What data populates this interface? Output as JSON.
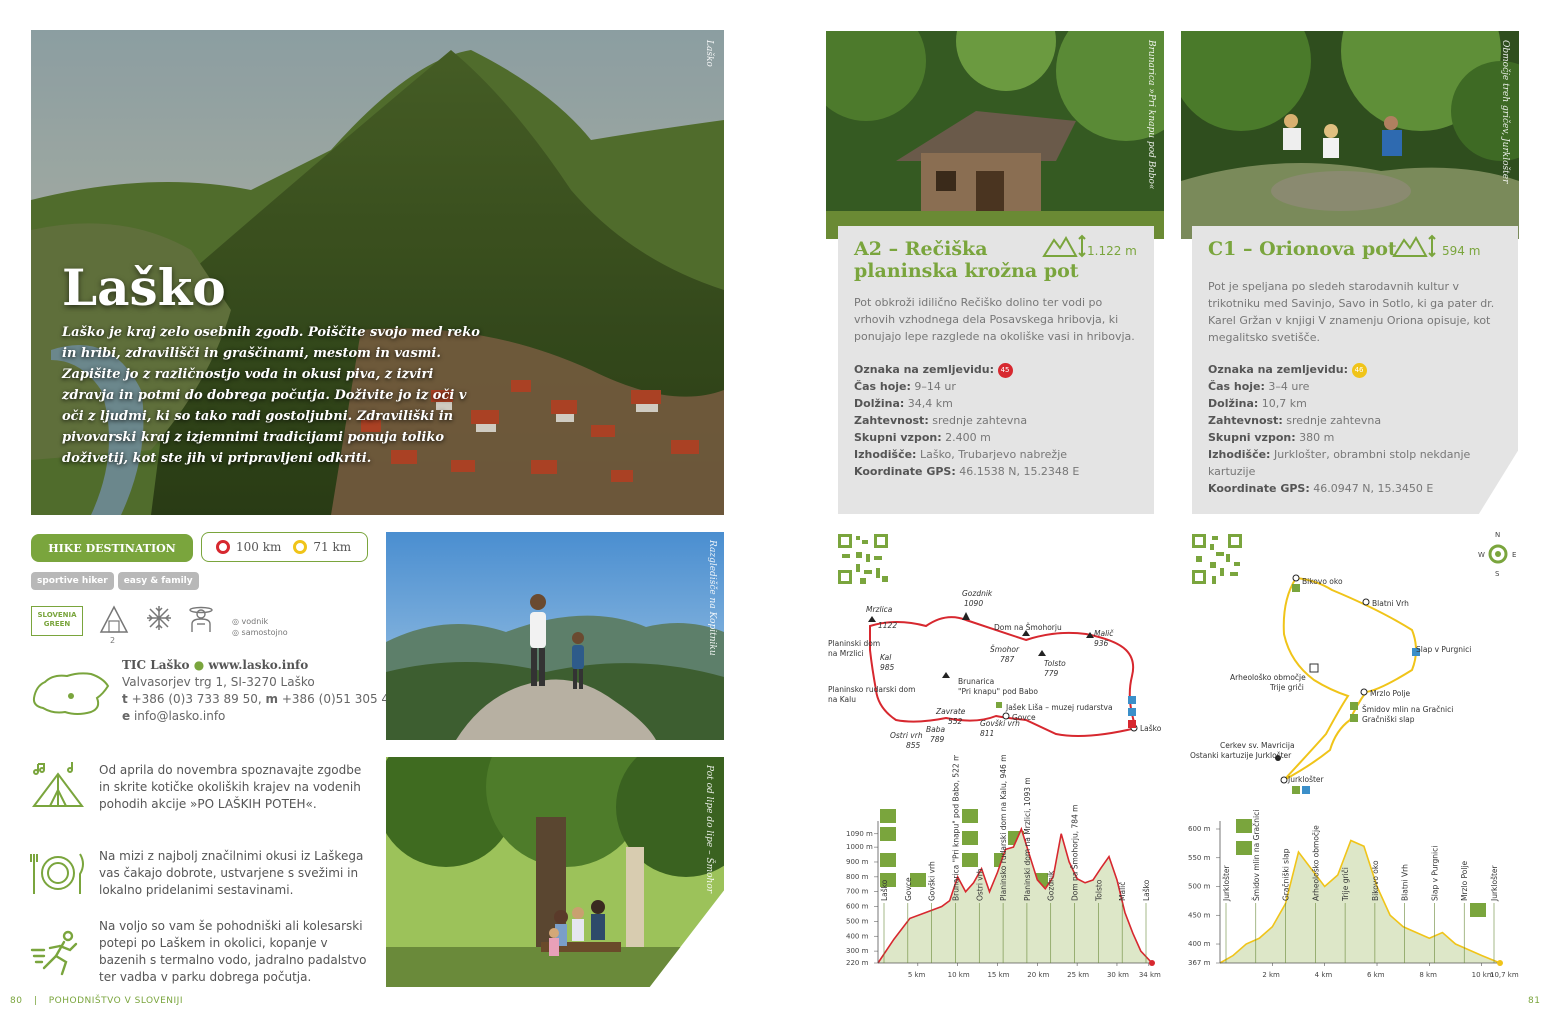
{
  "left_page": {
    "hero": {
      "title": "Laško",
      "intro": "Laško je kraj zelo osebnih zgodb. Poiščite svojo med reko in hribi, zdravilišči in graščinami, mestom in vasmi. Zapišite jo z različnostjo voda in okusi piva, z izviri zdravja in potmi do dobrega počutja. Doživite jo iz oči v oči z ljudmi, ki so tako radi gostoljubni. Zdraviliški in pivovarski kraj z izjemnimi tradicijami ponuja toliko doživetij, kot ste jih vi pripravljeni odkriti.",
      "credit": "Laško"
    },
    "destination_button": "HIKE DESTINATION",
    "distances": {
      "red": "100 km",
      "yellow": "71 km"
    },
    "tags": [
      "sportive hiker",
      "easy & family"
    ],
    "icons": [
      {
        "name": "slovenia-green-badge",
        "text": "SLOVENIA GREEN"
      },
      {
        "name": "hut-icon",
        "count": "2"
      },
      {
        "name": "snowflake-icon"
      },
      {
        "name": "guide-icon"
      }
    ],
    "guide_options": [
      "vodnik",
      "samostojno"
    ],
    "contact": {
      "tic": "TIC Laško",
      "web": "www.lasko.info",
      "address": "Valvasorjev trg 1, SI-3270 Laško",
      "t_label": "t",
      "phone": "+386 (0)3 733 89 50,",
      "m_label": "m",
      "mobile": "+386 (0)51 305 466",
      "e_label": "e",
      "email": "info@lasko.info"
    },
    "features": [
      {
        "icon": "tent-music-icon",
        "text": "Od aprila do novembra spoznavajte zgodbe in skrite kotičke okoliških krajev na vodenih pohodih akcije »PO LAŠKIH POTEH«."
      },
      {
        "icon": "plate-cutlery-icon",
        "text": "Na mizi z najbolj značilnimi okusi iz Laškega vas čakajo dobrote, ustvarjene s svežimi in lokalno pridelanimi sestavinami."
      },
      {
        "icon": "runner-icon",
        "text": "Na voljo so vam še pohodniški ali kolesarski potepi po Laškem in okolici, kopanje v bazenih s termalno vodo, jadralno padalstvo ter vadba v parku dobrega počutja."
      }
    ],
    "photo_credits": [
      "Razgledišče na Kopitniku",
      "Pot od lipe do lipe – Šmohor"
    ],
    "footer": {
      "page": "80",
      "separator": "|",
      "title": "POHODNIŠTVO V SLOVENIJI"
    }
  },
  "right_page": {
    "photo_credits": [
      "Brunarica »Pri knapu pod Babo«",
      "Območje treh gričev, Jurklošter"
    ],
    "routes": [
      {
        "code_title_1": "A2 – Rečiška",
        "code_title_2": "planinska krožna pot",
        "elevation": "1.122 m",
        "description": "Pot obkroži idilično Rečiško dolino ter vodi po vrhovih vzhodnega dela Posavskega hribovja, ki ponujajo lepe razglede na okoliške vasi in hribovja.",
        "map_label": "Oznaka na zemljevidu:",
        "map_number": "45",
        "map_color": "#d7282f",
        "specs": [
          {
            "k": "Čas hoje:",
            "v": "9–14 ur"
          },
          {
            "k": "Dolžina:",
            "v": "34,4 km"
          },
          {
            "k": "Zahtevnost:",
            "v": "srednje zahtevna"
          },
          {
            "k": "Skupni vzpon:",
            "v": "2.400 m"
          },
          {
            "k": "Izhodišče:",
            "v": "Laško, Trubarjevo nabrežje"
          },
          {
            "k": "Koordinate GPS:",
            "v": "46.1538 N, 15.2348 E"
          }
        ]
      },
      {
        "code_title_1": "C1 – Orionova pot",
        "code_title_2": "",
        "elevation": "594 m",
        "description": "Pot je speljana po sledeh starodavnih kultur v trikotniku med Savinjo, Savo in Sotlo, ki ga pater dr. Karel Gržan v knjigi V znamenju Oriona opisuje, kot megalitsko svetišče.",
        "map_label": "Oznaka na zemljevidu:",
        "map_number": "46",
        "map_color": "#f0c419",
        "specs": [
          {
            "k": "Čas hoje:",
            "v": "3–4 ure"
          },
          {
            "k": "Dolžina:",
            "v": "10,7 km"
          },
          {
            "k": "Zahtevnost:",
            "v": "srednje zahtevna"
          },
          {
            "k": "Skupni vzpon:",
            "v": "380 m"
          },
          {
            "k": "Izhodišče:",
            "v": "Jurklošter, obrambni stolp nekdanje kartuzije"
          },
          {
            "k": "Koordinate GPS:",
            "v": "46.0947 N, 15.3450 E"
          }
        ]
      }
    ],
    "map_a2_labels": {
      "gozdnik": "Gozdnik",
      "gozdnik_h": "1090",
      "mrzlica": "Mrzlica",
      "mrzlica_h": "1122",
      "dom_mrzlica_1": "Planinski dom",
      "dom_mrzlica_2": "na Mrzlici",
      "kal": "Kal",
      "kal_h": "985",
      "dom_kal_1": "Planinsko rudarski dom",
      "dom_kal_2": "na Kalu",
      "dom_smohor": "Dom na Šmohorju",
      "smohor": "Šmohor",
      "smohor_h": "787",
      "tolsto": "Tolsto",
      "tolsto_h": "779",
      "malic": "Malič",
      "malic_h": "936",
      "brunarica_1": "Brunarica",
      "brunarica_2": "\"Pri knapu\" pod Babo",
      "zavrate": "Zavrate",
      "zavrate_h": "552",
      "baba": "Baba",
      "baba_h": "789",
      "ostri": "Ostri vrh",
      "ostri_h": "855",
      "govski": "Govški vrh",
      "govski_h": "811",
      "govce": "Govce",
      "jasek": "Jašek Liša – muzej rudarstva",
      "lasko": "Laško"
    },
    "map_c1_labels": {
      "bikovo": "Bikovo oko",
      "blatni": "Blatni Vrh",
      "slap": "Slap v Purgnici",
      "arheolosko_1": "Arheološko območje",
      "arheolosko_2": "Trije griči",
      "mrzlo": "Mrzlo Polje",
      "smidov_1": "Šmidov mlin na Gračnici",
      "smidov_2": "Gračniški slap",
      "cerkev_1": "Cerkev sv. Mavricija",
      "cerkev_2": "Ostanki kartuzije Jurklošter",
      "jurklostr": "Jurklošter",
      "compass_n": "N",
      "compass_s": "S",
      "compass_w": "W",
      "compass_e": "E"
    },
    "footer_page": "81"
  },
  "chart_data": [
    {
      "type": "area",
      "title": "",
      "xlabel": "",
      "ylabel": "",
      "x_ticks": [
        "5 km",
        "10 km",
        "15 km",
        "20 km",
        "25 km",
        "30 km",
        "34 km"
      ],
      "y_ticks": [
        "220 m",
        "300 m",
        "400 m",
        "500 m",
        "600 m",
        "700 m",
        "800 m",
        "900 m",
        "1000 m",
        "1090 m"
      ],
      "x": [
        0,
        2,
        4,
        6,
        8,
        9,
        10,
        11,
        12,
        13,
        14,
        15,
        16,
        17,
        18,
        19,
        20,
        21,
        22,
        23,
        24,
        25,
        26,
        27,
        28,
        29,
        30,
        31,
        32,
        33,
        34.4
      ],
      "y": [
        220,
        380,
        520,
        560,
        600,
        640,
        800,
        700,
        760,
        855,
        700,
        830,
        985,
        1000,
        1122,
        950,
        780,
        720,
        800,
        1090,
        900,
        787,
        760,
        779,
        860,
        936,
        780,
        560,
        420,
        300,
        220
      ],
      "point_labels": [
        "Laško",
        "Govce",
        "Govški vrh",
        "Brunarica \"Pri knapu\" pod Babo, 522 m",
        "Ostri vrh",
        "Planinsko rudarski dom na Kalu, 946 m",
        "Planinski dom na Mrzlici, 1093 m",
        "Gozdnik",
        "Dom na Šmohorju, 784 m",
        "Tolsto",
        "Malič",
        "Laško"
      ]
    },
    {
      "type": "area",
      "title": "",
      "xlabel": "",
      "ylabel": "",
      "x_ticks": [
        "2 km",
        "4 km",
        "6 km",
        "8 km",
        "10 km",
        "10,7 km"
      ],
      "y_ticks": [
        "367 m",
        "400 m",
        "450 m",
        "500 m",
        "550 m",
        "600 m"
      ],
      "x": [
        0,
        0.5,
        1,
        1.5,
        2,
        2.5,
        3,
        3.5,
        4,
        4.5,
        5,
        5.5,
        6,
        6.5,
        7,
        7.5,
        8,
        8.5,
        9,
        9.5,
        10,
        10.7
      ],
      "y": [
        367,
        380,
        400,
        410,
        430,
        470,
        560,
        530,
        500,
        520,
        580,
        570,
        500,
        450,
        430,
        420,
        410,
        420,
        400,
        390,
        380,
        367
      ],
      "point_labels": [
        "Jurklošter",
        "Šmidov mlin na Gračnici",
        "Gračniški slap",
        "Arheološko območje",
        "Trije griči",
        "Bikovo oko",
        "Blatni Vrh",
        "Slap v Purgnici",
        "Mrzlo Polje",
        "Jurklošter"
      ]
    }
  ]
}
